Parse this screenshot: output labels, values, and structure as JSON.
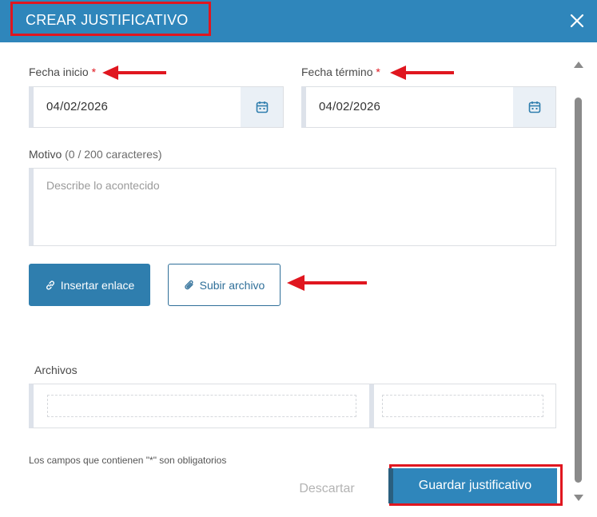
{
  "modal": {
    "title": "CREAR JUSTIFICATIVO",
    "close_icon": "close-icon"
  },
  "form": {
    "fecha_inicio": {
      "label": "Fecha inicio",
      "required_mark": "*",
      "value": "04/02/2026",
      "icon": "calendar-icon"
    },
    "fecha_termino": {
      "label": "Fecha término",
      "required_mark": "*",
      "value": "04/02/2026",
      "icon": "calendar-icon"
    },
    "motivo": {
      "label": "Motivo",
      "counter": "(0 / 200 caracteres)",
      "placeholder": "Describe lo acontecido",
      "value": ""
    },
    "insert_link_button": {
      "label": "Insertar enlace",
      "icon": "link-icon"
    },
    "upload_file_button": {
      "label": "Subir archivo",
      "icon": "paperclip-icon"
    },
    "archivos": {
      "label": "Archivos"
    },
    "required_note": "Los campos que contienen \"*\" son obligatorios"
  },
  "footer": {
    "discard_label": "Descartar",
    "save_label": "Guardar justificativo"
  },
  "colors": {
    "header": "#2f86bb",
    "primary_button": "#2f7eae",
    "highlight": "#e0161f"
  }
}
